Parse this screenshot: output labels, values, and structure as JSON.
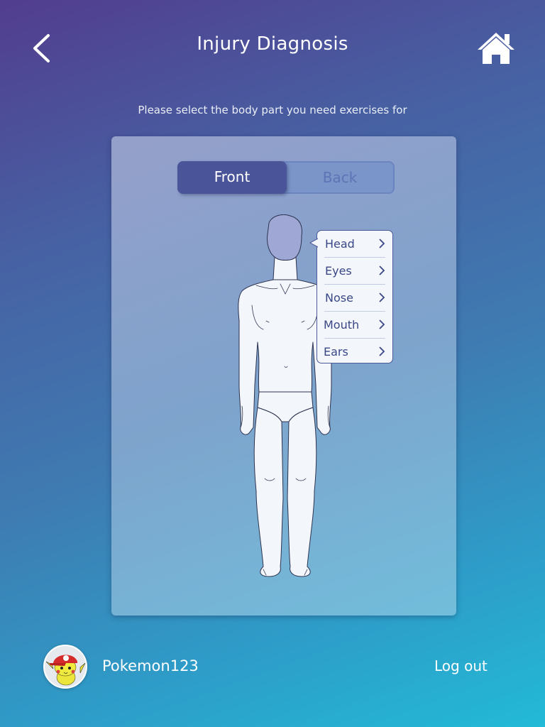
{
  "header": {
    "title": "Injury Diagnosis",
    "back_icon": "chevron-left-icon",
    "home_icon": "home-icon"
  },
  "instruction": "Please select the body part you need exercises for",
  "view_toggle": {
    "options": [
      "Front",
      "Back"
    ],
    "selected": "Front"
  },
  "body_map": {
    "selected_region": "Head",
    "submenu": [
      "Head",
      "Eyes",
      "Nose",
      "Mouth",
      "Ears"
    ]
  },
  "footer": {
    "username": "Pokemon123",
    "logout_label": "Log out"
  },
  "colors": {
    "gradient_start": "#523d8e",
    "gradient_end": "#22bad6",
    "toggle_active": "#4a5499",
    "toggle_inactive_text": "#5f74b6",
    "menu_text": "#3a4786",
    "selected_region": "#9fa8d4"
  }
}
